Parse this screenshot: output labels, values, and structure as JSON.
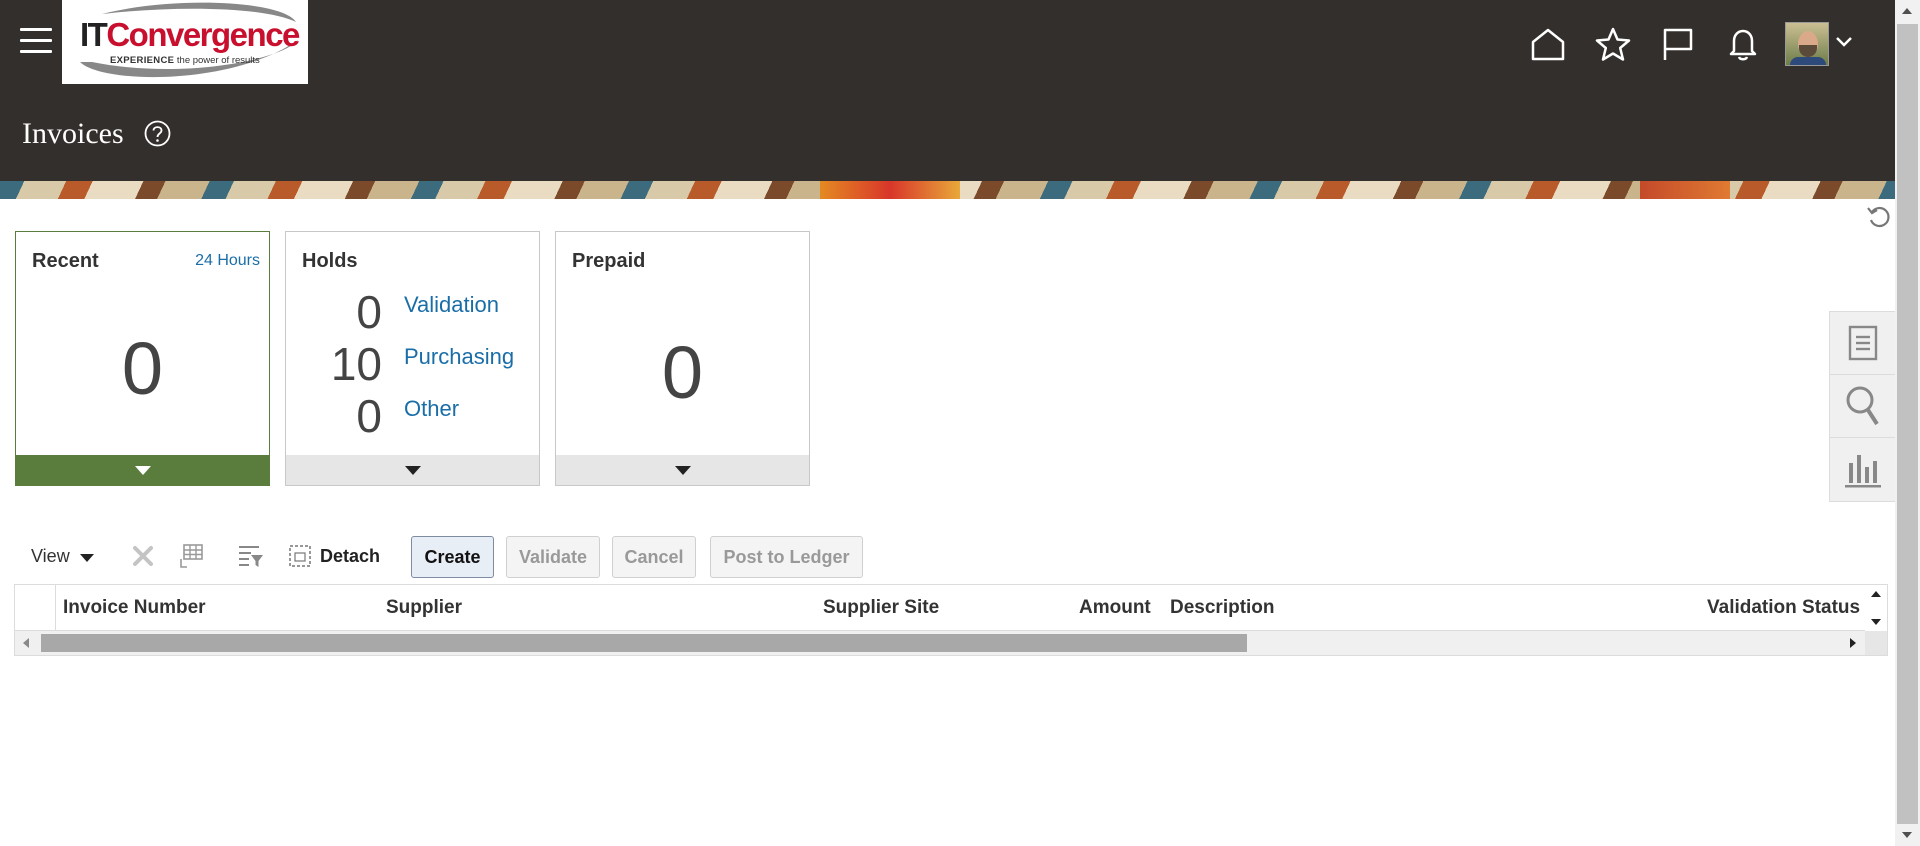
{
  "header": {
    "logo": {
      "brand_it": "IT",
      "brand_conv": "Convergence",
      "tagline_bold": "EXPERIENCE",
      "tagline_rest": "the power of results"
    },
    "page_title": "Invoices",
    "icons": [
      "home-icon",
      "favorites-star-icon",
      "watchlist-flag-icon",
      "notifications-bell-icon"
    ],
    "avatar": "user-avatar"
  },
  "tiles": {
    "recent": {
      "title": "Recent",
      "subtitle": "24 Hours",
      "value": "0"
    },
    "holds": {
      "title": "Holds",
      "rows": [
        {
          "count": "0",
          "label": "Validation"
        },
        {
          "count": "10",
          "label": "Purchasing"
        },
        {
          "count": "0",
          "label": "Other"
        }
      ]
    },
    "prepaid": {
      "title": "Prepaid",
      "value": "0"
    }
  },
  "side_panel": [
    "tasks-icon",
    "search-icon",
    "reports-chart-icon"
  ],
  "toolbar": {
    "view_label": "View",
    "detach_label": "Detach",
    "buttons": {
      "create": "Create",
      "validate": "Validate",
      "cancel": "Cancel",
      "post": "Post to Ledger"
    }
  },
  "table": {
    "columns": [
      "Invoice Number",
      "Supplier",
      "Supplier Site",
      "Amount",
      "Description",
      "Validation Status"
    ],
    "rows": []
  },
  "colors": {
    "header_bg": "#332f2c",
    "link": "#1a6ea8",
    "tile_selected": "#5a7d3e",
    "brand_red": "#c8102e"
  }
}
